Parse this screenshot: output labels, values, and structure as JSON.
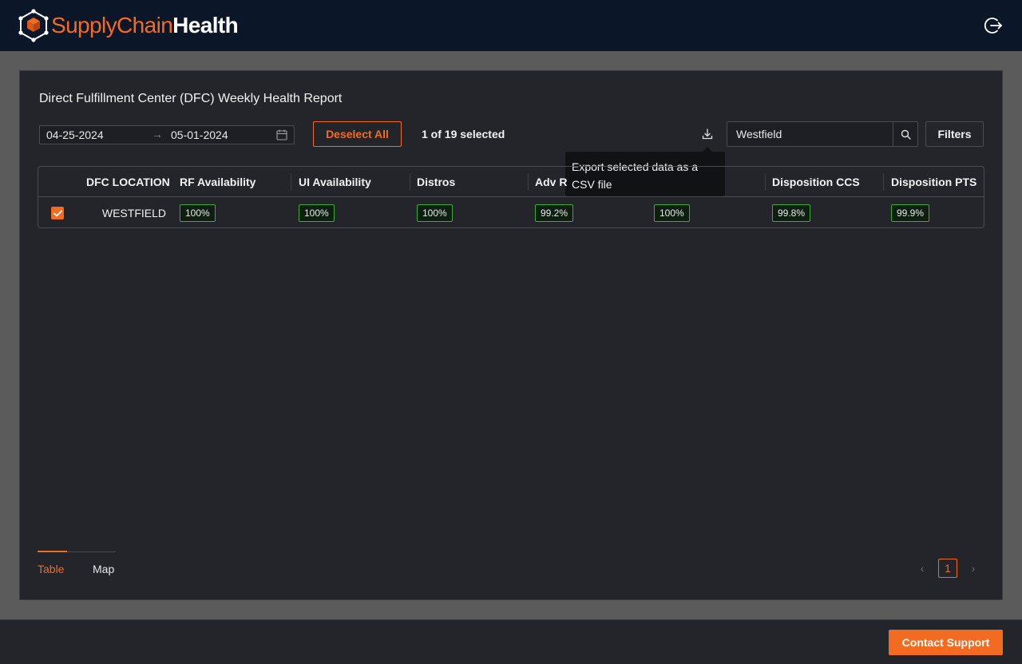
{
  "app": {
    "logo_part1": "SupplyChain",
    "logo_part2": "Health"
  },
  "report": {
    "title": "Direct Fulfillment Center (DFC) Weekly Health Report",
    "date_start": "04-25-2024",
    "date_arrow": "→",
    "date_end": "05-01-2024",
    "deselect_label": "Deselect All",
    "selected_count": "1 of 19 selected",
    "export_tooltip": "Export selected data as a CSV file",
    "search_value": "Westfield",
    "filters_label": "Filters"
  },
  "table": {
    "columns": [
      "DFC LOCATION",
      "RF Availability",
      "UI Availability",
      "Distros",
      "Adv R",
      "",
      "Disposition CCS",
      "Disposition PTS"
    ],
    "rows": [
      {
        "checked": true,
        "location": "WESTFIELD",
        "values": [
          "100%",
          "100%",
          "100%",
          "99.2%",
          "100%",
          "99.8%",
          "99.9%"
        ]
      }
    ]
  },
  "tabs": {
    "table_label": "Table",
    "map_label": "Map"
  },
  "pagination": {
    "current_page": "1",
    "prev": "‹",
    "next": "›"
  },
  "footer": {
    "contact_label": "Contact Support"
  },
  "colors": {
    "brand_orange": "#f26b21",
    "header_bg": "#0b1628",
    "panel_bg": "#23252b",
    "badge_green": "#3fa83a"
  }
}
